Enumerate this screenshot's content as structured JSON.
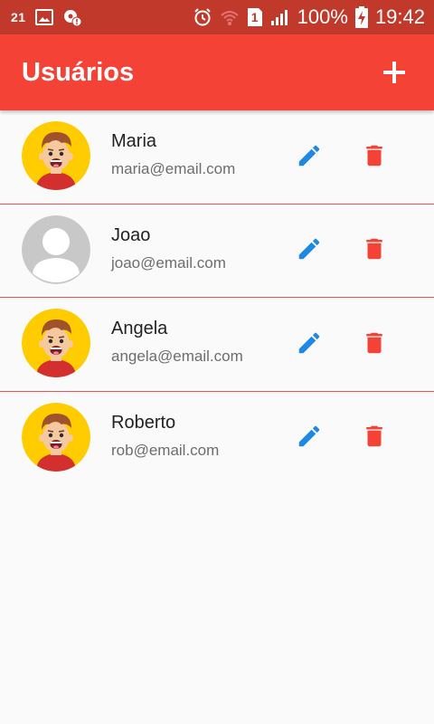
{
  "status_bar": {
    "left_number": "21",
    "battery_text": "100%",
    "time": "19:42",
    "sim_badge": "1",
    "icons": [
      "image-icon",
      "settings-alert-icon",
      "alarm-icon",
      "wifi-icon",
      "sim-icon",
      "signal-icon",
      "battery-charging-icon"
    ]
  },
  "app_bar": {
    "title": "Usuários",
    "add_icon": "plus-icon"
  },
  "users": [
    {
      "name": "Maria",
      "email": "maria@email.com",
      "avatar": "cartoon-avatar-icon"
    },
    {
      "name": "Joao",
      "email": "joao@email.com",
      "avatar": "default-avatar-icon"
    },
    {
      "name": "Angela",
      "email": "angela@email.com",
      "avatar": "cartoon-avatar-icon"
    },
    {
      "name": "Roberto",
      "email": "rob@email.com",
      "avatar": "cartoon-avatar-icon"
    }
  ],
  "colors": {
    "status_bar": "#c0392b",
    "app_bar": "#f44336",
    "edit": "#1e88e5",
    "delete": "#f44336",
    "divider": "#ef5350"
  }
}
